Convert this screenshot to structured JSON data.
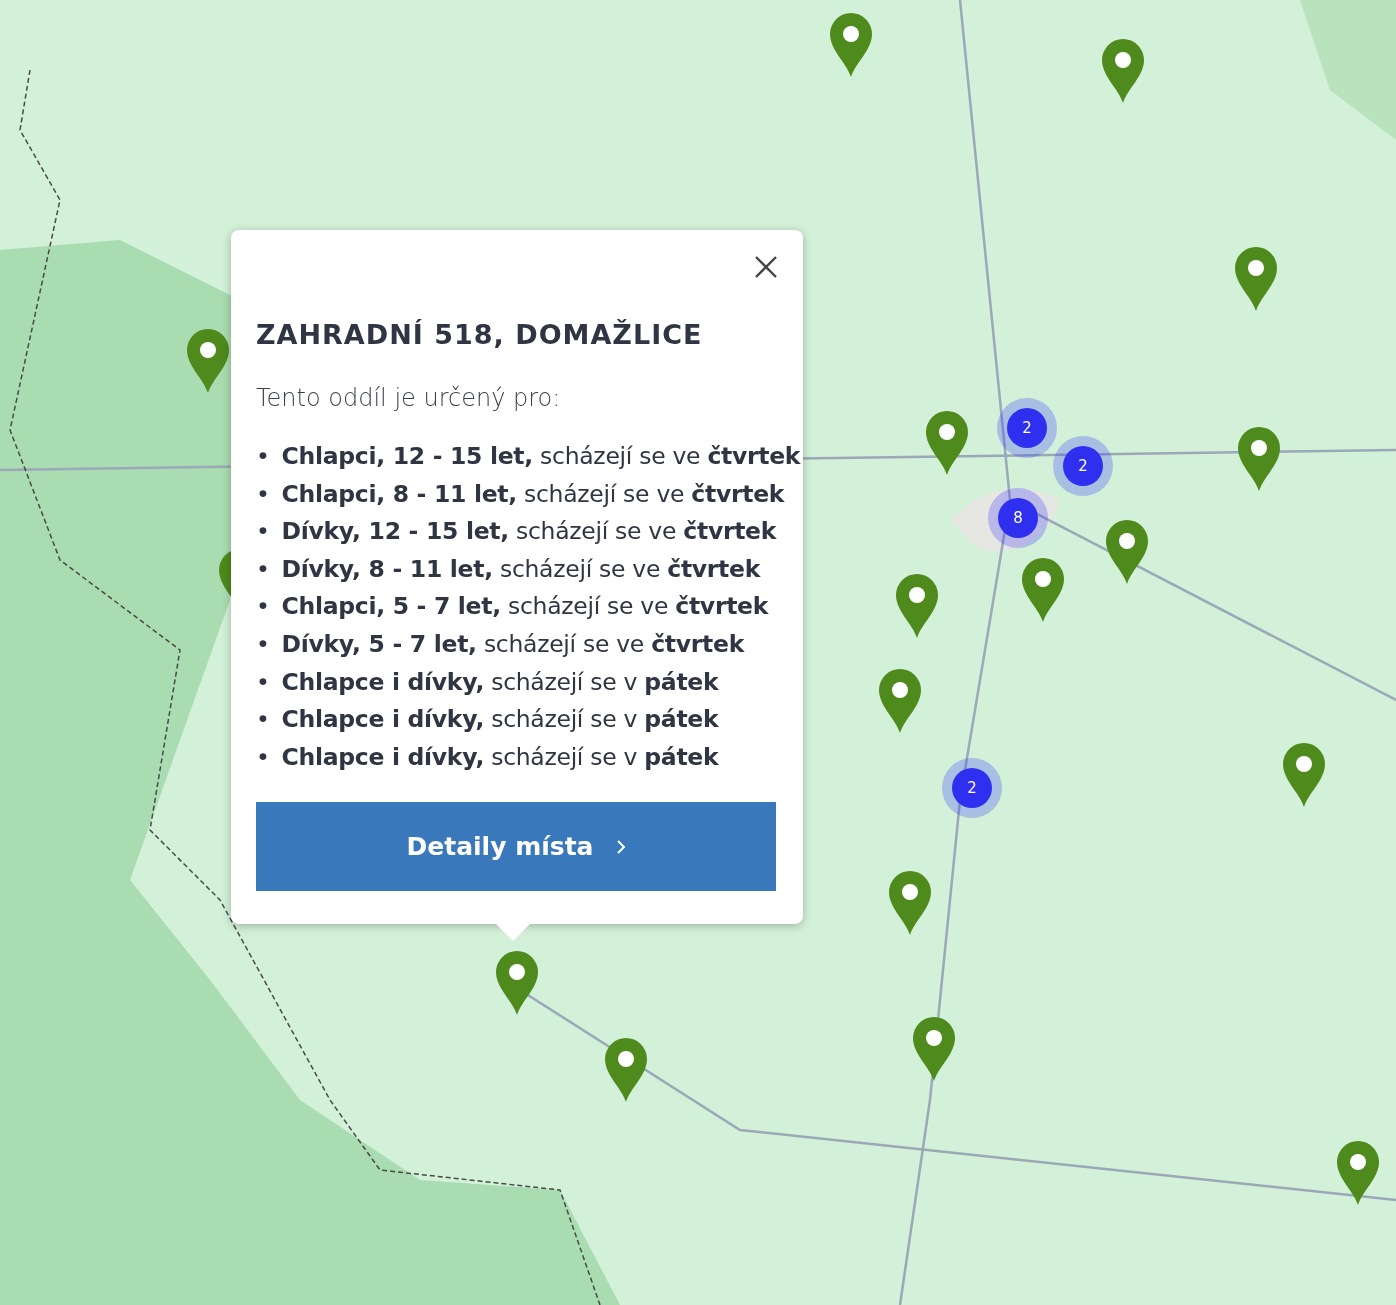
{
  "map": {
    "markers": [
      {
        "kind": "pin"
      },
      {
        "kind": "pin"
      },
      {
        "kind": "pin"
      },
      {
        "kind": "pin"
      },
      {
        "kind": "pin"
      },
      {
        "kind": "pin"
      },
      {
        "kind": "pin"
      },
      {
        "kind": "pin"
      },
      {
        "kind": "pin"
      },
      {
        "kind": "pin"
      },
      {
        "kind": "pin"
      },
      {
        "kind": "pin"
      },
      {
        "kind": "pin"
      },
      {
        "kind": "pin"
      },
      {
        "kind": "pin"
      },
      {
        "kind": "pin"
      },
      {
        "kind": "pin"
      },
      {
        "kind": "cluster",
        "count": "2"
      },
      {
        "kind": "cluster",
        "count": "2"
      },
      {
        "kind": "cluster",
        "count": "8"
      },
      {
        "kind": "cluster",
        "count": "2"
      }
    ]
  },
  "popup": {
    "title": "ZAHRADNÍ 518, DOMAŽLICE",
    "intro": "Tento oddíl je určený pro:",
    "groups": [
      {
        "bullet": "•",
        "text": "**Chlapci, 12 - 15 let,** scházejí se ve **čtvrtek**"
      },
      {
        "bullet": "•",
        "text": "**Chlapci, 8 - 11 let,** scházejí se ve **čtvrtek**"
      },
      {
        "bullet": "•",
        "text": "**Dívky, 12 - 15 let,** scházejí se ve **čtvrtek**"
      },
      {
        "bullet": "•",
        "text": "**Dívky, 8 - 11 let,** scházejí se ve **čtvrtek**"
      },
      {
        "bullet": "•",
        "text": "**Chlapci, 5 - 7 let,** scházejí se ve **čtvrtek**"
      },
      {
        "bullet": "•",
        "text": "**Dívky, 5 - 7 let,** scházejí se ve **čtvrtek**"
      },
      {
        "bullet": "•",
        "text": "**Chlapce i dívky,** scházejí se v **pátek**"
      },
      {
        "bullet": "•",
        "text": "**Chlapce i dívky,** scházejí se v **pátek**"
      },
      {
        "bullet": "•",
        "text": "**Chlapce i dívky,** scházejí se v **pátek**"
      }
    ],
    "button": "Detaily místa"
  }
}
